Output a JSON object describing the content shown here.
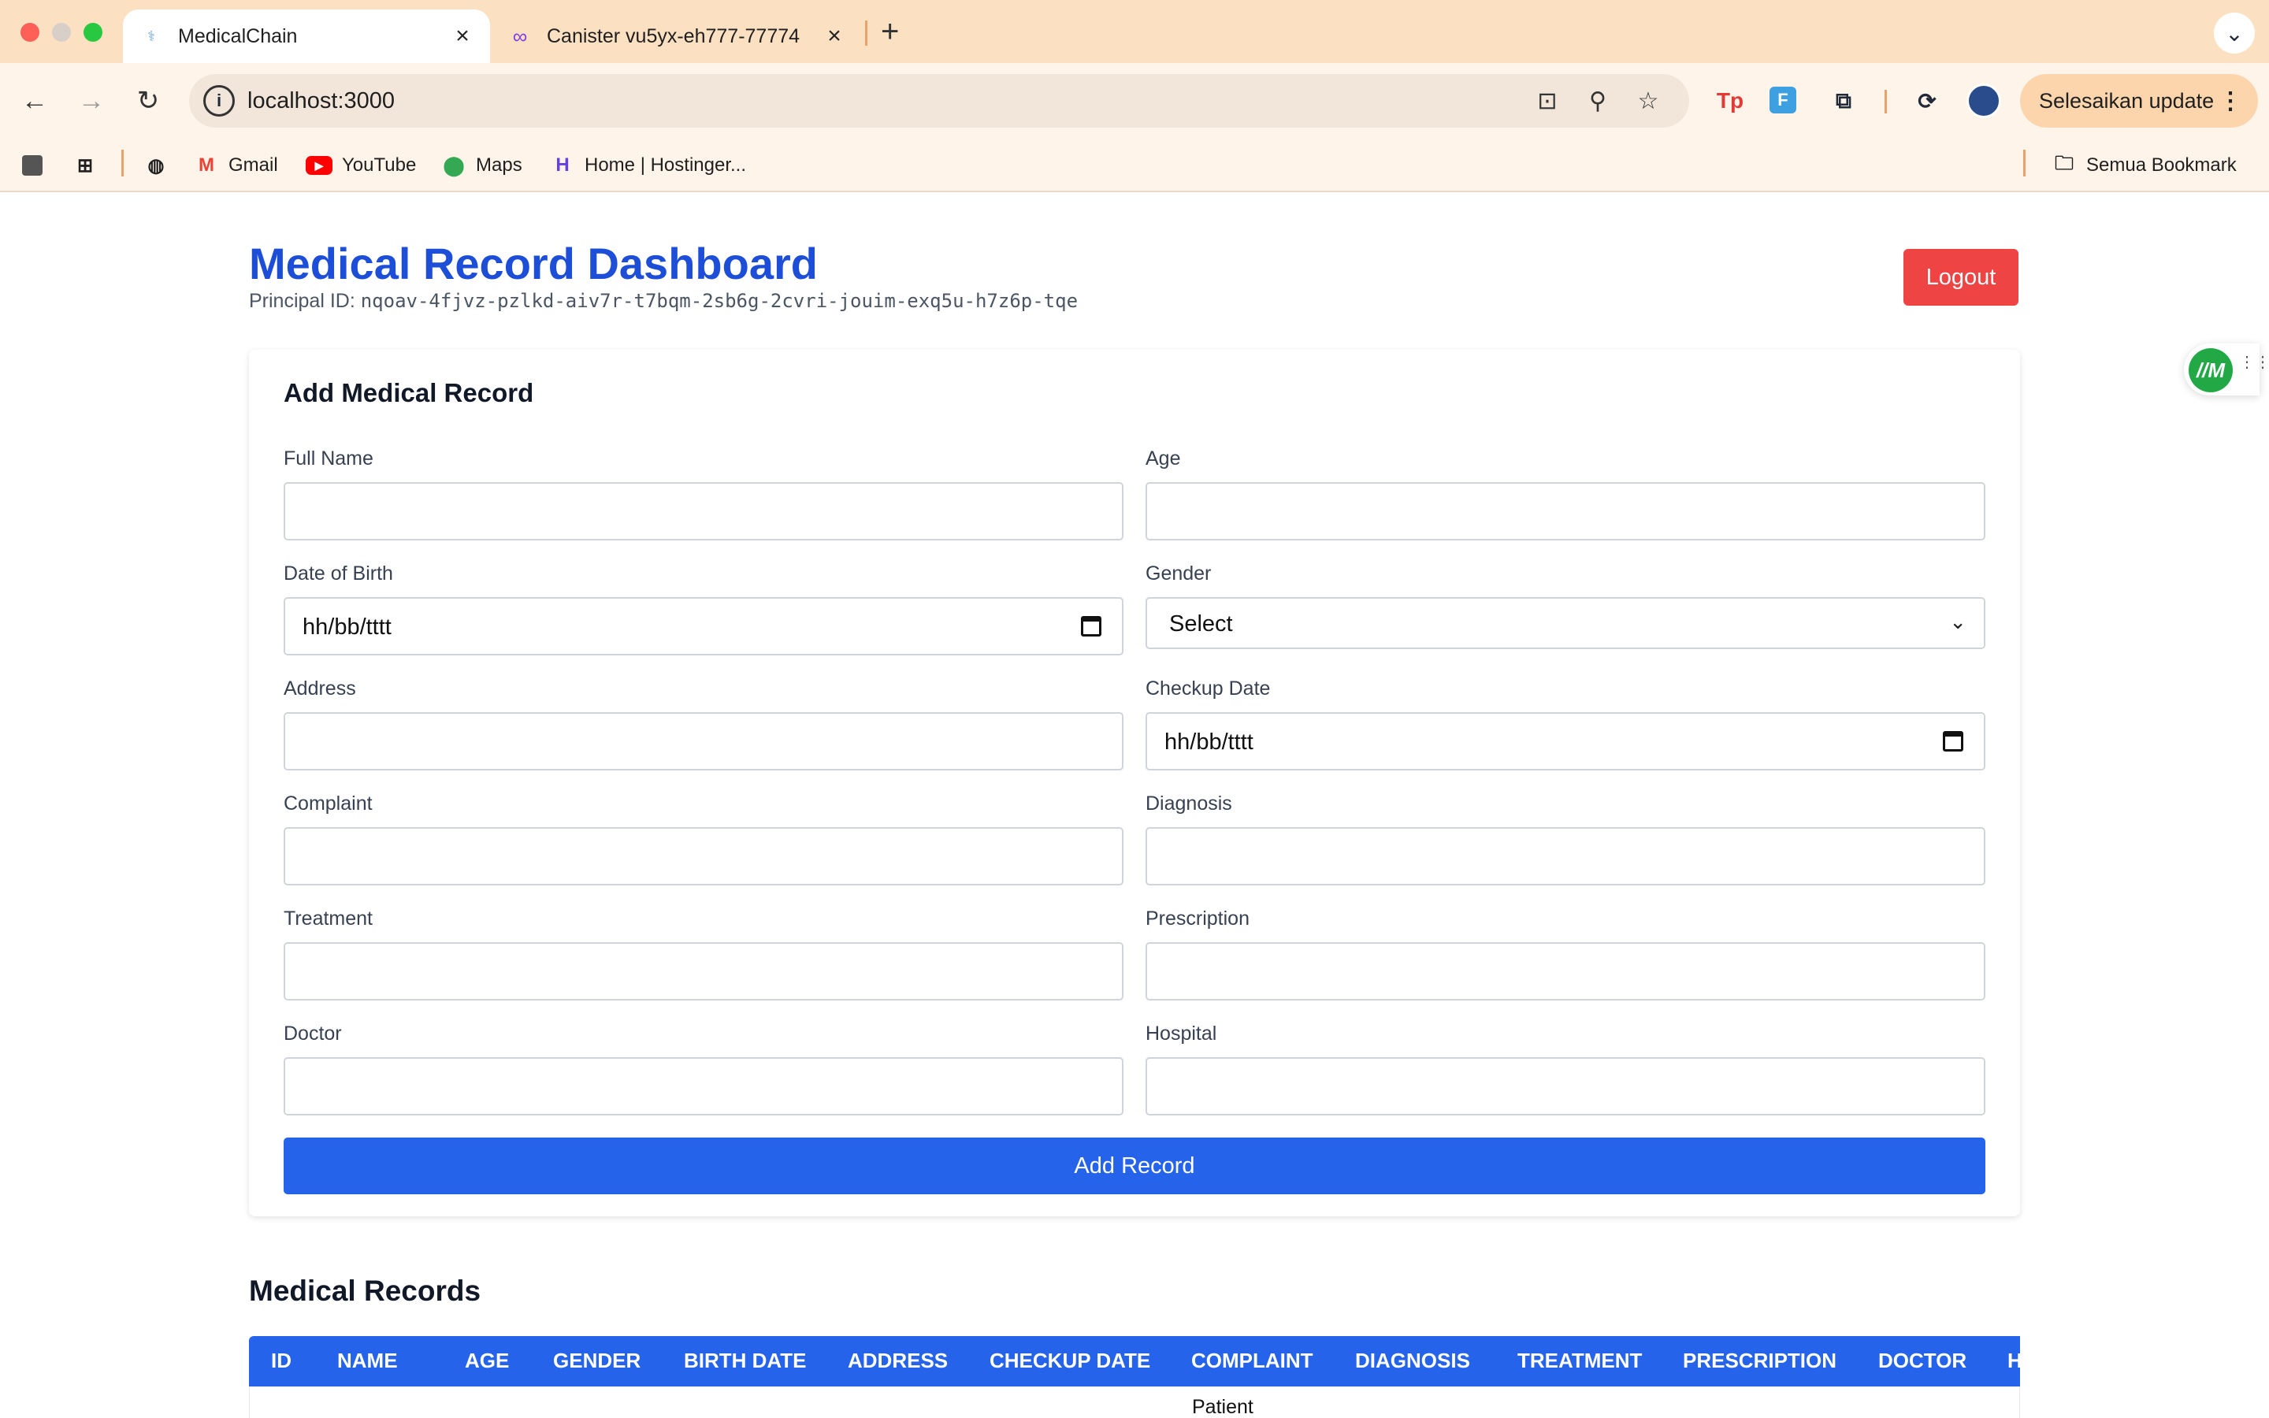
{
  "browser": {
    "tabs": [
      {
        "title": "MedicalChain",
        "favicon": "medicalchain-icon",
        "active": true
      },
      {
        "title": "Canister vu5yx-eh777-77774",
        "favicon": "infinity-icon",
        "active": false
      }
    ],
    "url": "localhost:3000",
    "update_label": "Selesaikan update",
    "bookmarks": [
      {
        "label": "Gmail",
        "icon": "gmail-icon"
      },
      {
        "label": "YouTube",
        "icon": "youtube-icon"
      },
      {
        "label": "Maps",
        "icon": "maps-icon"
      },
      {
        "label": "Home | Hostinger...",
        "icon": "hostinger-icon"
      }
    ],
    "all_bookmarks_label": "Semua Bookmark",
    "extensions": [
      "Tp",
      "F"
    ]
  },
  "header": {
    "title": "Medical Record Dashboard",
    "principal_label": "Principal ID:",
    "principal_id": "nqoav-4fjvz-pzlkd-aiv7r-t7bqm-2sb6g-2cvri-jouim-exq5u-h7z6p-tqe",
    "logout_label": "Logout"
  },
  "form": {
    "title": "Add Medical Record",
    "fields": {
      "full_name": {
        "label": "Full Name",
        "value": ""
      },
      "age": {
        "label": "Age",
        "value": ""
      },
      "dob": {
        "label": "Date of Birth",
        "value": "hh/bb/tttt"
      },
      "gender": {
        "label": "Gender",
        "value": "Select"
      },
      "address": {
        "label": "Address",
        "value": ""
      },
      "checkup_date": {
        "label": "Checkup Date",
        "value": "hh/bb/tttt"
      },
      "complaint": {
        "label": "Complaint",
        "value": ""
      },
      "diagnosis": {
        "label": "Diagnosis",
        "value": ""
      },
      "treatment": {
        "label": "Treatment",
        "value": ""
      },
      "prescription": {
        "label": "Prescription",
        "value": ""
      },
      "doctor": {
        "label": "Doctor",
        "value": ""
      },
      "hospital": {
        "label": "Hospital",
        "value": ""
      }
    },
    "submit_label": "Add Record"
  },
  "records": {
    "title": "Medical Records",
    "columns": [
      "ID",
      "NAME",
      "AGE",
      "GENDER",
      "BIRTH DATE",
      "ADDRESS",
      "CHECKUP DATE",
      "COMPLAINT",
      "DIAGNOSIS",
      "TREATMENT",
      "PRESCRIPTION",
      "DOCTOR",
      "H"
    ],
    "first_row_complaint": "Patient"
  },
  "colors": {
    "accent": "#2563eb",
    "title": "#1d4ed8",
    "danger": "#ef4444"
  }
}
